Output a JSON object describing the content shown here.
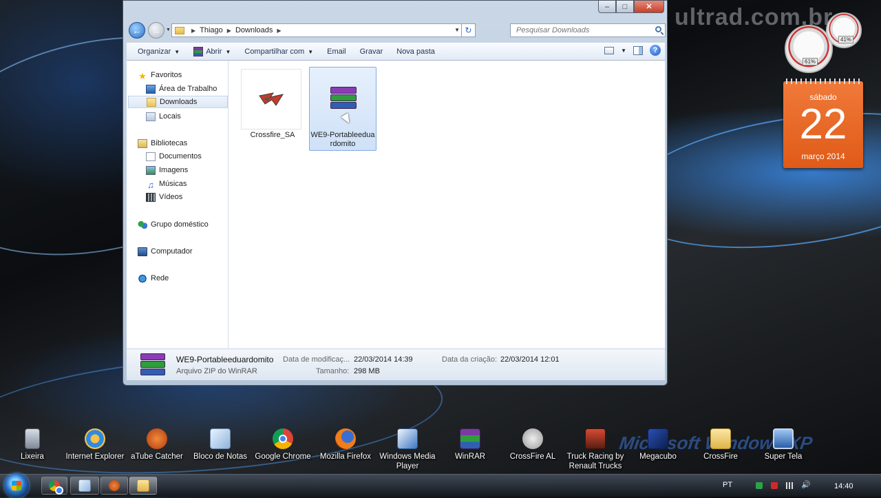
{
  "desktop": {
    "watermark": "ultrad.com.br",
    "logo_text": "Microsoft Windows XP",
    "icons": [
      {
        "label": "Lixeira",
        "icon": "recycle-bin-icon"
      },
      {
        "label": "Internet Explorer",
        "icon": "internet-explorer-icon"
      },
      {
        "label": "aTube Catcher",
        "icon": "atube-catcher-icon"
      },
      {
        "label": "Bloco de Notas",
        "icon": "notepad-icon"
      },
      {
        "label": "Google Chrome",
        "icon": "chrome-icon"
      },
      {
        "label": "Mozilla Firefox",
        "icon": "firefox-icon"
      },
      {
        "label": "Windows Media Player",
        "icon": "media-player-icon"
      },
      {
        "label": "WinRAR",
        "icon": "winrar-icon"
      },
      {
        "label": "CrossFire AL",
        "icon": "crossfire-icon"
      },
      {
        "label": "Truck Racing by Renault Trucks",
        "icon": "truck-racing-icon"
      },
      {
        "label": "Megacubo",
        "icon": "megacubo-icon"
      },
      {
        "label": "CrossFire",
        "icon": "folder-icon"
      },
      {
        "label": "Super Tela",
        "icon": "tv-icon"
      }
    ]
  },
  "gadgets": {
    "cpu_meter": {
      "cpu_percent": "61%",
      "ram_percent": "41%"
    },
    "calendar": {
      "weekday": "sábado",
      "day": "22",
      "month_year": "março 2014"
    }
  },
  "window": {
    "address": {
      "crumbs": [
        "Thiago",
        "Downloads"
      ]
    },
    "search": {
      "placeholder": "Pesquisar Downloads"
    },
    "toolbar": {
      "organize": "Organizar",
      "open": "Abrir",
      "share": "Compartilhar com",
      "email": "Email",
      "burn": "Gravar",
      "new_folder": "Nova pasta"
    },
    "nav": {
      "favorites": "Favoritos",
      "desktop": "Área de Trabalho",
      "downloads": "Downloads",
      "places": "Locais",
      "libraries": "Bibliotecas",
      "documents": "Documentos",
      "images": "Imagens",
      "music": "Músicas",
      "videos": "Vídeos",
      "homegroup": "Grupo doméstico",
      "computer": "Computador",
      "network": "Rede"
    },
    "files": [
      {
        "name": "Crossfire_SA",
        "selected": false
      },
      {
        "name": "WE9-Portableeduardomito",
        "selected": true
      }
    ],
    "details": {
      "name": "WE9-Portableeduardomito",
      "type": "Arquivo ZIP do WinRAR",
      "modified_label": "Data de modificaç...",
      "modified_value": "22/03/2014 14:39",
      "created_label": "Data da criação:",
      "created_value": "22/03/2014 12:01",
      "size_label": "Tamanho:",
      "size_value": "298 MB"
    }
  },
  "taskbar": {
    "language": "PT",
    "clock": "14:40",
    "pinned": [
      "chrome-icon",
      "notepad-icon",
      "atube-catcher-icon",
      "explorer-icon"
    ]
  }
}
